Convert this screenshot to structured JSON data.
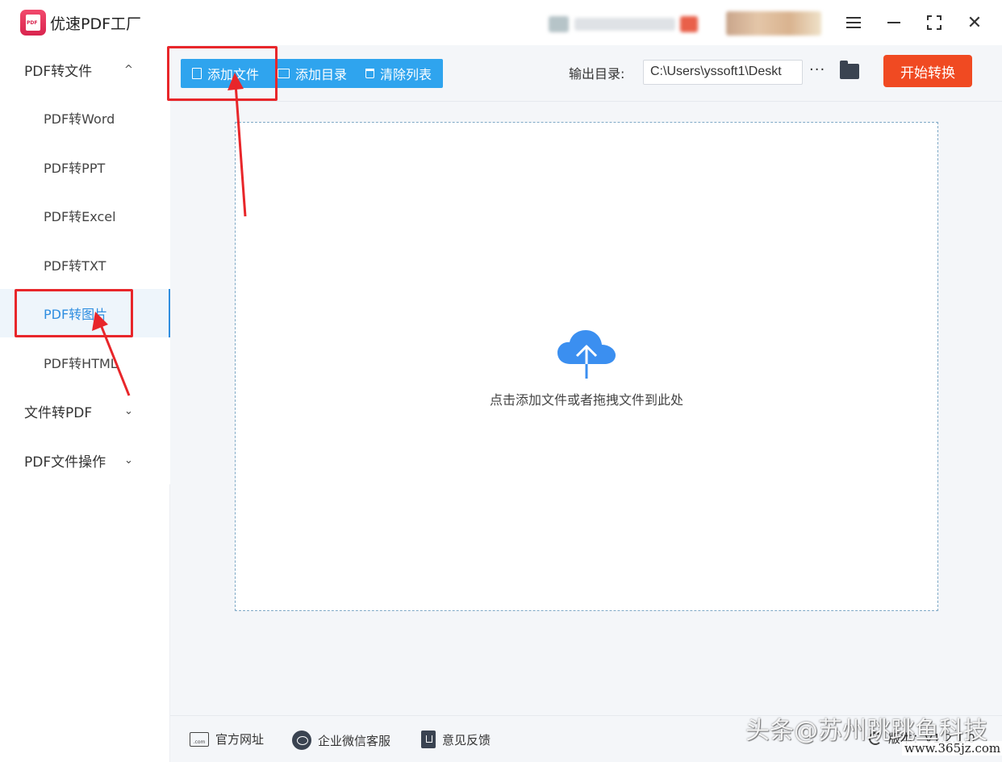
{
  "app": {
    "title": "优速PDF工厂",
    "logo_text": "PDF"
  },
  "sidebar": {
    "groups": [
      {
        "label": "PDF转文件",
        "chevron": "^"
      },
      {
        "label": "文件转PDF",
        "chevron": "⌄"
      },
      {
        "label": "PDF文件操作",
        "chevron": "⌄"
      }
    ],
    "items": [
      {
        "label": "PDF转Word"
      },
      {
        "label": "PDF转PPT"
      },
      {
        "label": "PDF转Excel"
      },
      {
        "label": "PDF转TXT"
      },
      {
        "label": "PDF转图片"
      },
      {
        "label": "PDF转HTML"
      }
    ],
    "active_item": "PDF转图片"
  },
  "toolbar": {
    "add_file": "添加文件",
    "add_dir": "添加目录",
    "clear_list": "清除列表",
    "output_label": "输出目录:",
    "output_path": "C:\\Users\\yssoft1\\Deskt",
    "more": "···",
    "start": "开始转换"
  },
  "dropzone": {
    "hint": "点击添加文件或者拖拽文件到此处"
  },
  "footer": {
    "site_icon_text": ".com",
    "site": "官方网址",
    "wechat": "企业微信客服",
    "feedback": "意见反馈",
    "version": "版本：V1.2.1.0"
  },
  "watermarks": {
    "brand": "头条@苏州跳跳鱼科技",
    "site": "www.365jz.com"
  },
  "colors": {
    "accent": "#2fa4ee",
    "start": "#f04a22",
    "annotation": "#e8262a",
    "active": "#2f8ee0"
  }
}
